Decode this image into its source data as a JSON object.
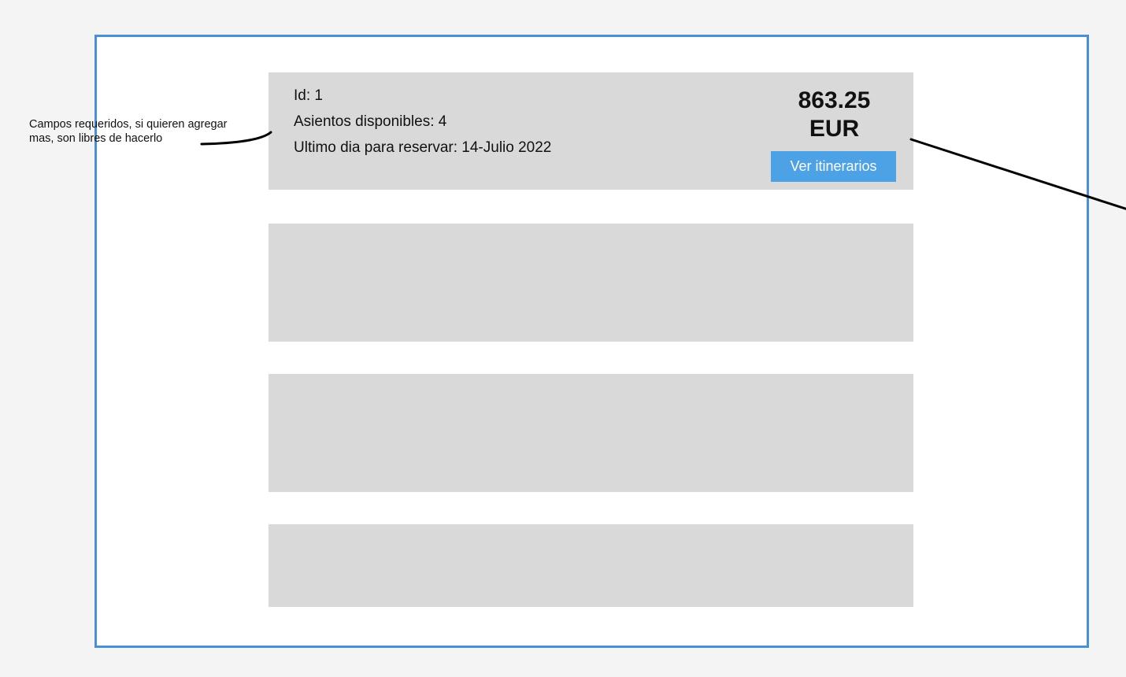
{
  "annotation": {
    "line1": "Campos requeridos, si quieren agregar",
    "line2": "mas, son libres de hacerlo"
  },
  "flight_card": {
    "id": "Id: 1",
    "seats": "Asientos disponibles: 4",
    "deadline": "Ultimo dia para reservar: 14-Julio 2022",
    "price_amount": "863.25",
    "price_currency": "EUR",
    "button_label": "Ver itinerarios"
  },
  "colors": {
    "frame_border": "#4a90d9",
    "card_background": "#d9d9d9",
    "button_background": "#4da2e6",
    "button_text": "#ffffff"
  }
}
